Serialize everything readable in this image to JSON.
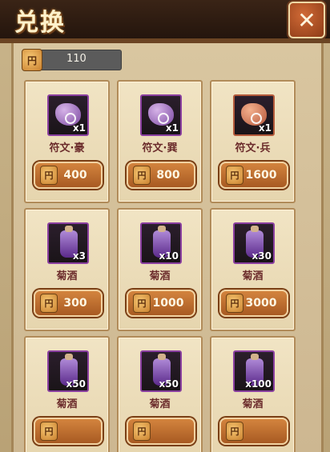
{
  "title": "兑换",
  "currency": {
    "icon": "coin-icon",
    "amount": "110"
  },
  "items": [
    {
      "type": "rune",
      "color": "purple",
      "qty": "x1",
      "name": "符文·豪",
      "price": "400"
    },
    {
      "type": "rune",
      "color": "purple",
      "qty": "x1",
      "name": "符文·巽",
      "price": "800"
    },
    {
      "type": "rune",
      "color": "orange",
      "qty": "x1",
      "name": "符文·兵",
      "price": "1600"
    },
    {
      "type": "wine",
      "color": "purple",
      "qty": "x3",
      "name": "菊酒",
      "price": "300"
    },
    {
      "type": "wine",
      "color": "purple",
      "qty": "x10",
      "name": "菊酒",
      "price": "1000"
    },
    {
      "type": "wine",
      "color": "purple",
      "qty": "x30",
      "name": "菊酒",
      "price": "3000"
    },
    {
      "type": "wine",
      "color": "purple",
      "qty": "x50",
      "name": "菊酒",
      "price": ""
    },
    {
      "type": "wine",
      "color": "purple",
      "qty": "x50",
      "name": "菊酒",
      "price": ""
    },
    {
      "type": "wine",
      "color": "purple",
      "qty": "x100",
      "name": "菊酒",
      "price": ""
    }
  ],
  "close_icon": "close-icon"
}
